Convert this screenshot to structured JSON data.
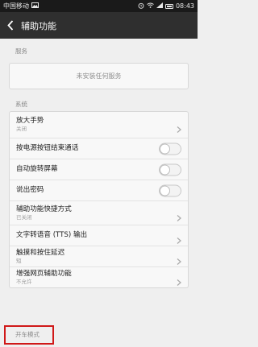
{
  "status_bar": {
    "carrier": "中国移动",
    "time": "08:43",
    "icons": [
      "image-icon",
      "alarm-icon",
      "wifi-icon",
      "signal-icon",
      "battery-icon"
    ]
  },
  "toolbar": {
    "title": "辅助功能",
    "back_icon": "chevron-left-icon"
  },
  "services": {
    "section_label": "服务",
    "empty_text": "未安装任何服务"
  },
  "system": {
    "section_label": "系统",
    "items": [
      {
        "title": "放大手势",
        "subtitle": "关闭",
        "control": "chevron"
      },
      {
        "title": "按电源按钮结束通话",
        "subtitle": "",
        "control": "toggle",
        "on": false
      },
      {
        "title": "自动旋转屏幕",
        "subtitle": "",
        "control": "toggle",
        "on": false
      },
      {
        "title": "说出密码",
        "subtitle": "",
        "control": "toggle",
        "on": false
      },
      {
        "title": "辅助功能快捷方式",
        "subtitle": "已关闭",
        "control": "chevron"
      },
      {
        "title": "文字转语音 (TTS) 输出",
        "subtitle": "",
        "control": "chevron"
      },
      {
        "title": "触摸和按住延迟",
        "subtitle": "短",
        "control": "chevron"
      },
      {
        "title": "增强网页辅助功能",
        "subtitle": "不允许",
        "control": "chevron"
      }
    ]
  },
  "bottom_section": {
    "label": "开车模式"
  },
  "colors": {
    "toolbar_bg": "#2f2f2f",
    "status_bg": "#1a1a1a",
    "page_bg": "#efefef",
    "highlight": "#d01818"
  }
}
